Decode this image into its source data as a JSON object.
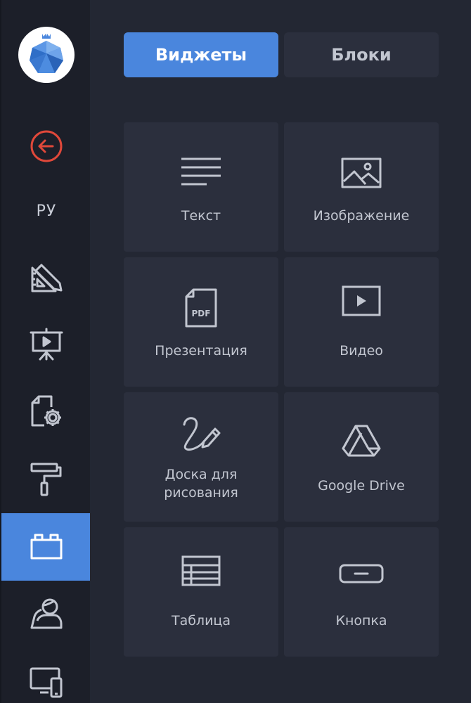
{
  "sidebar": {
    "language": "РУ",
    "items": [
      {
        "name": "back",
        "icon": "back-arrow-icon"
      },
      {
        "name": "language",
        "icon": "language-label"
      },
      {
        "name": "design",
        "icon": "ruler-pencil-icon"
      },
      {
        "name": "presentation",
        "icon": "presentation-board-icon"
      },
      {
        "name": "settings",
        "icon": "file-gear-icon"
      },
      {
        "name": "theme",
        "icon": "paint-roller-icon"
      },
      {
        "name": "widgets",
        "icon": "blocks-icon",
        "active": true
      },
      {
        "name": "users",
        "icon": "user-icon"
      },
      {
        "name": "devices",
        "icon": "devices-icon"
      }
    ]
  },
  "tabs": {
    "widgets": "Виджеты",
    "blocks": "Блоки"
  },
  "widgets": [
    {
      "label": "Текст",
      "icon": "text-lines-icon"
    },
    {
      "label": "Изображение",
      "icon": "image-icon"
    },
    {
      "label": "Презентация",
      "icon": "pdf-file-icon",
      "icon_text": "PDF"
    },
    {
      "label": "Видео",
      "icon": "video-play-icon"
    },
    {
      "label": "Доска для рисования",
      "icon": "drawing-pen-icon"
    },
    {
      "label": "Google Drive",
      "icon": "google-drive-icon"
    },
    {
      "label": "Таблица",
      "icon": "table-icon"
    },
    {
      "label": "Кнопка",
      "icon": "button-icon"
    }
  ],
  "colors": {
    "accent": "#4a86dd",
    "sidebar_bg": "#1c1f29",
    "panel_bg": "#232733",
    "tile_bg": "#2b2f3d",
    "icon": "#c2c6d0",
    "back_icon": "#e0483a"
  }
}
